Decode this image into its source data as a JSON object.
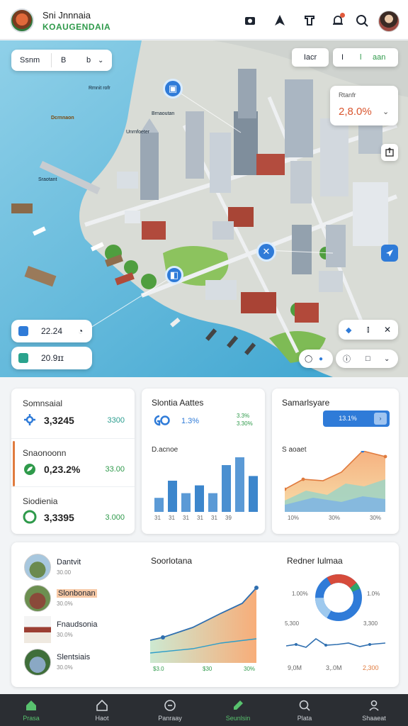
{
  "header": {
    "title": "Sni Jnnnaia",
    "subtitle": "KOAUGENDAIA"
  },
  "map": {
    "selector_left": "Ssnm",
    "selector_mid": "B",
    "selector_right": "b",
    "tab_1": "Iacr",
    "tab_2": "I",
    "tab_3": "l",
    "tab_4": "aan",
    "stat_label": "Rtanfr",
    "stat_value": "2,8.0%",
    "labels": [
      "Rmnit rofr",
      "Dcrnnaon",
      "Brnaoutan",
      "Unrnfoeter",
      "Sraotant"
    ],
    "metric_1": "22.24",
    "metric_2": "20.9ɪɪ"
  },
  "kpis": [
    {
      "label": "Somnsaial",
      "value": "3,3245",
      "delta": "3300"
    },
    {
      "label": "Snaonoonn",
      "value": "0,23.2%",
      "delta": "33.00"
    },
    {
      "label": "Siodienia",
      "value": "3,3395",
      "delta": "3.000"
    }
  ],
  "bar_card": {
    "title": "Slontia Aattes",
    "value": "1.3%",
    "delta_1": "3.3%",
    "delta_2": "3.30%",
    "subtitle": "D.acnoe",
    "ticks": [
      "31",
      "31",
      "31",
      "31",
      "31",
      "39"
    ],
    "values": [
      18,
      40,
      24,
      34,
      24,
      60,
      70,
      46
    ]
  },
  "area_card": {
    "title": "Samarlsyare",
    "button": "13.1%",
    "subtitle": "S aoaet",
    "ticks": [
      "10%",
      "30%",
      "30%"
    ]
  },
  "places": [
    {
      "name": "Dantvit",
      "sub": "30.00"
    },
    {
      "name": "Slonbonan",
      "sub": "30.0%"
    },
    {
      "name": "Fnaudsonia",
      "sub": "30.0%"
    },
    {
      "name": "Slentsiais",
      "sub": "30.0%"
    }
  ],
  "trend_card": {
    "title": "Soorlotana",
    "ticks": [
      "$3.0",
      "$30",
      "30%"
    ]
  },
  "donut_card": {
    "title": "Redner Iulmaa",
    "label_tl": "1.00%",
    "label_tr": "1.0%",
    "label_ml": "5,300",
    "label_mr": "3,300",
    "ticks": [
      "9,0M",
      "3,.0M",
      "2,300"
    ]
  },
  "nav": [
    {
      "label": "Prasa"
    },
    {
      "label": "Haot"
    },
    {
      "label": "Panraay"
    },
    {
      "label": "Seunlsin"
    },
    {
      "label": "Plata"
    },
    {
      "label": "Shaaeat"
    }
  ],
  "colors": {
    "accent_green": "#2f9a4b",
    "accent_blue": "#2f7bd8",
    "accent_orange": "#e07b3e",
    "nav_bg": "#2b2e33"
  }
}
